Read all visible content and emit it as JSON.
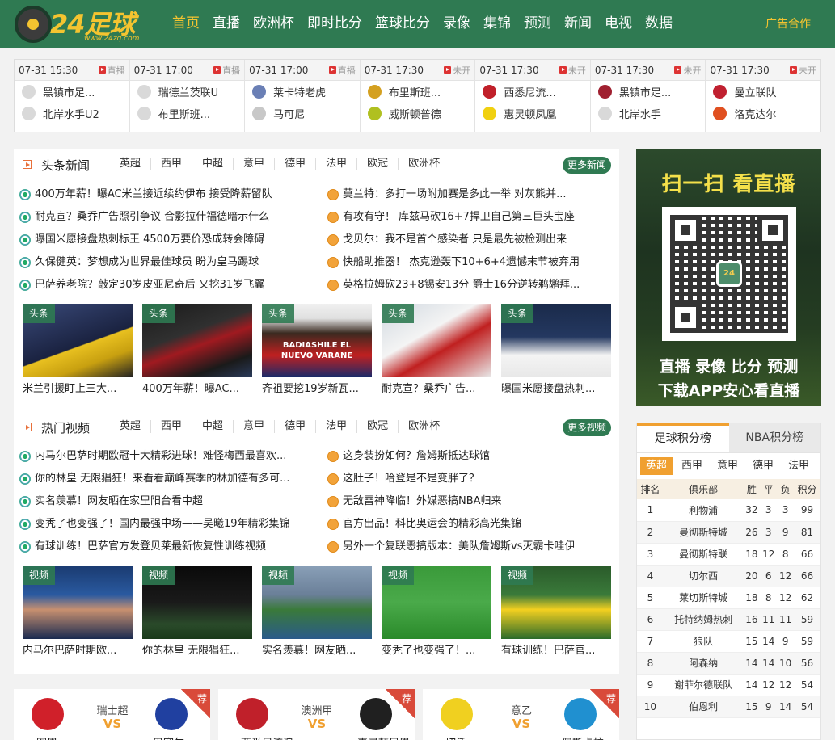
{
  "header": {
    "logo_text": "24足球",
    "logo_url": "www.24zq.com",
    "nav": [
      "首页",
      "直播",
      "欧洲杯",
      "即时比分",
      "篮球比分",
      "录像",
      "集锦",
      "预测",
      "新闻",
      "电视",
      "数据"
    ],
    "ad": "广告合作"
  },
  "matches": [
    {
      "time": "07-31 15:30",
      "status": "直播",
      "home": "黑镇市足...",
      "away": "北岸水手U2",
      "home_color": "#d9d9d9",
      "away_color": "#d9d9d9"
    },
    {
      "time": "07-31 17:00",
      "status": "直播",
      "home": "瑞德兰茨联U",
      "away": "布里斯班...",
      "home_color": "#d9d9d9",
      "away_color": "#d9d9d9"
    },
    {
      "time": "07-31 17:00",
      "status": "直播",
      "home": "莱卡特老虎",
      "away": "马可尼",
      "home_color": "#6a7fb5",
      "away_color": "#c8c8c8"
    },
    {
      "time": "07-31 17:30",
      "status": "未开",
      "home": "布里斯班...",
      "away": "威斯顿普德",
      "home_color": "#d4a020",
      "away_color": "#b0c020"
    },
    {
      "time": "07-31 17:30",
      "status": "未开",
      "home": "西悉尼流...",
      "away": "惠灵顿凤凰",
      "home_color": "#c0202a",
      "away_color": "#f0d010"
    },
    {
      "time": "07-31 17:30",
      "status": "未开",
      "home": "黑镇市足...",
      "away": "北岸水手",
      "home_color": "#a02030",
      "away_color": "#d9d9d9"
    },
    {
      "time": "07-31 17:30",
      "status": "未开",
      "home": "曼立联队",
      "away": "洛克达尔",
      "home_color": "#c02030",
      "away_color": "#e05020"
    }
  ],
  "news": {
    "title": "头条新闻",
    "tabs": [
      "英超",
      "西甲",
      "中超",
      "意甲",
      "德甲",
      "法甲",
      "欧冠",
      "欧洲杯"
    ],
    "more": "更多新闻",
    "left": [
      "400万年薪！曝AC米兰接近续约伊布 接受降薪留队",
      "耐克宣？桑乔广告照引争议 合影拉什福德暗示什么",
      "曝国米愿接盘热刺标王 4500万要价恐成转会障碍",
      "久保健英：梦想成为世界最佳球员 盼为皇马踢球",
      "巴萨养老院？敲定30岁皮亚尼奇后 又挖31岁飞翼"
    ],
    "right": [
      "莫兰特：多打一场附加赛是多此一举 对灰熊并...",
      "有攻有守！ 库兹马砍16+7捍卫自己第三巨头宝座",
      "戈贝尔：我不是首个感染者 只是最先被检测出来",
      "快船助推器！ 杰克逊轰下10+6+4遗憾末节被弃用",
      "英格拉姆砍23+8锡安13分 爵士16分逆转鹈鹕拜..."
    ],
    "thumbs": [
      {
        "tag": "头条",
        "cap": "米兰引援盯上三大..."
      },
      {
        "tag": "头条",
        "cap": "400万年薪！曝AC..."
      },
      {
        "tag": "头条",
        "cap": "齐祖要挖19岁新瓦..."
      },
      {
        "tag": "头条",
        "cap": "耐克宣？桑乔广告..."
      },
      {
        "tag": "头条",
        "cap": "曝国米愿接盘热刺..."
      }
    ],
    "thumb_text": "BADIASHILE EL NUEVO VARANE"
  },
  "videos": {
    "title": "热门视频",
    "tabs": [
      "英超",
      "西甲",
      "中超",
      "意甲",
      "德甲",
      "法甲",
      "欧冠",
      "欧洲杯"
    ],
    "more": "更多视频",
    "left": [
      "内马尔巴萨时期欧冠十大精彩进球！难怪梅西最喜欢...",
      "你的林皇 无限猖狂！来看看巅峰赛季的林加德有多可...",
      "实名羡慕！网友晒在家里阳台看中超",
      "变秃了也变强了！国内最强中场——吴曦19年精彩集锦",
      "有球训练！巴萨官方发登贝莱最新恢复性训练视频"
    ],
    "right": [
      "这身装扮如何？詹姆斯抵达球馆",
      "这肚子！哈登是不是变胖了？",
      "无敌雷神降临！外媒恶搞NBA归来",
      "官方出品！科比奥运会的精彩高光集锦",
      "另外一个复联恶搞版本：美队詹姆斯vs灭霸卡哇伊"
    ],
    "thumbs": [
      {
        "tag": "视频",
        "cap": "内马尔巴萨时期欧..."
      },
      {
        "tag": "视频",
        "cap": "你的林皇 无限猖狂..."
      },
      {
        "tag": "视频",
        "cap": "实名羡慕！网友晒..."
      },
      {
        "tag": "视频",
        "cap": "变秃了也变强了！..."
      },
      {
        "tag": "视频",
        "cap": "有球训练！巴萨官..."
      }
    ]
  },
  "qr": {
    "title": "扫一扫 看直播",
    "line1": "直播 录像 比分 预测",
    "line2": "下载APP安心看直播",
    "center": "24"
  },
  "standings": {
    "tabs": [
      "足球积分榜",
      "NBA积分榜"
    ],
    "leagues": [
      "英超",
      "西甲",
      "意甲",
      "德甲",
      "法甲"
    ],
    "headers": [
      "排名",
      "俱乐部",
      "胜",
      "平",
      "负",
      "积分"
    ],
    "rows": [
      [
        "1",
        "利物浦",
        "32",
        "3",
        "3",
        "99"
      ],
      [
        "2",
        "曼彻斯特城",
        "26",
        "3",
        "9",
        "81"
      ],
      [
        "3",
        "曼彻斯特联",
        "18",
        "12",
        "8",
        "66"
      ],
      [
        "4",
        "切尔西",
        "20",
        "6",
        "12",
        "66"
      ],
      [
        "5",
        "莱切斯特城",
        "18",
        "8",
        "12",
        "62"
      ],
      [
        "6",
        "托特纳姆热刺",
        "16",
        "11",
        "11",
        "59"
      ],
      [
        "7",
        "狼队",
        "15",
        "14",
        "9",
        "59"
      ],
      [
        "8",
        "阿森纳",
        "14",
        "14",
        "10",
        "56"
      ],
      [
        "9",
        "谢菲尔德联队",
        "14",
        "12",
        "12",
        "54"
      ],
      [
        "10",
        "伯恩利",
        "15",
        "9",
        "14",
        "54"
      ]
    ]
  },
  "cards": [
    {
      "league": "瑞士超",
      "vs": "VS",
      "rec": "荐",
      "cut": "图恩",
      "cut_r": "巴塞尔",
      "left_color": "#d0202a",
      "right_color": "#2040a0"
    },
    {
      "league": "澳洲甲",
      "vs": "VS",
      "rec": "荐",
      "cut": "西悉尼流浪",
      "cut_r": "惠灵顿凤凰",
      "left_color": "#c0202a",
      "right_color": "#202020"
    },
    {
      "league": "意乙",
      "vs": "VS",
      "rec": "荐",
      "cut": "切沃",
      "cut_r": "佩斯卡拉",
      "left_color": "#f0d020",
      "right_color": "#2090d0"
    }
  ]
}
